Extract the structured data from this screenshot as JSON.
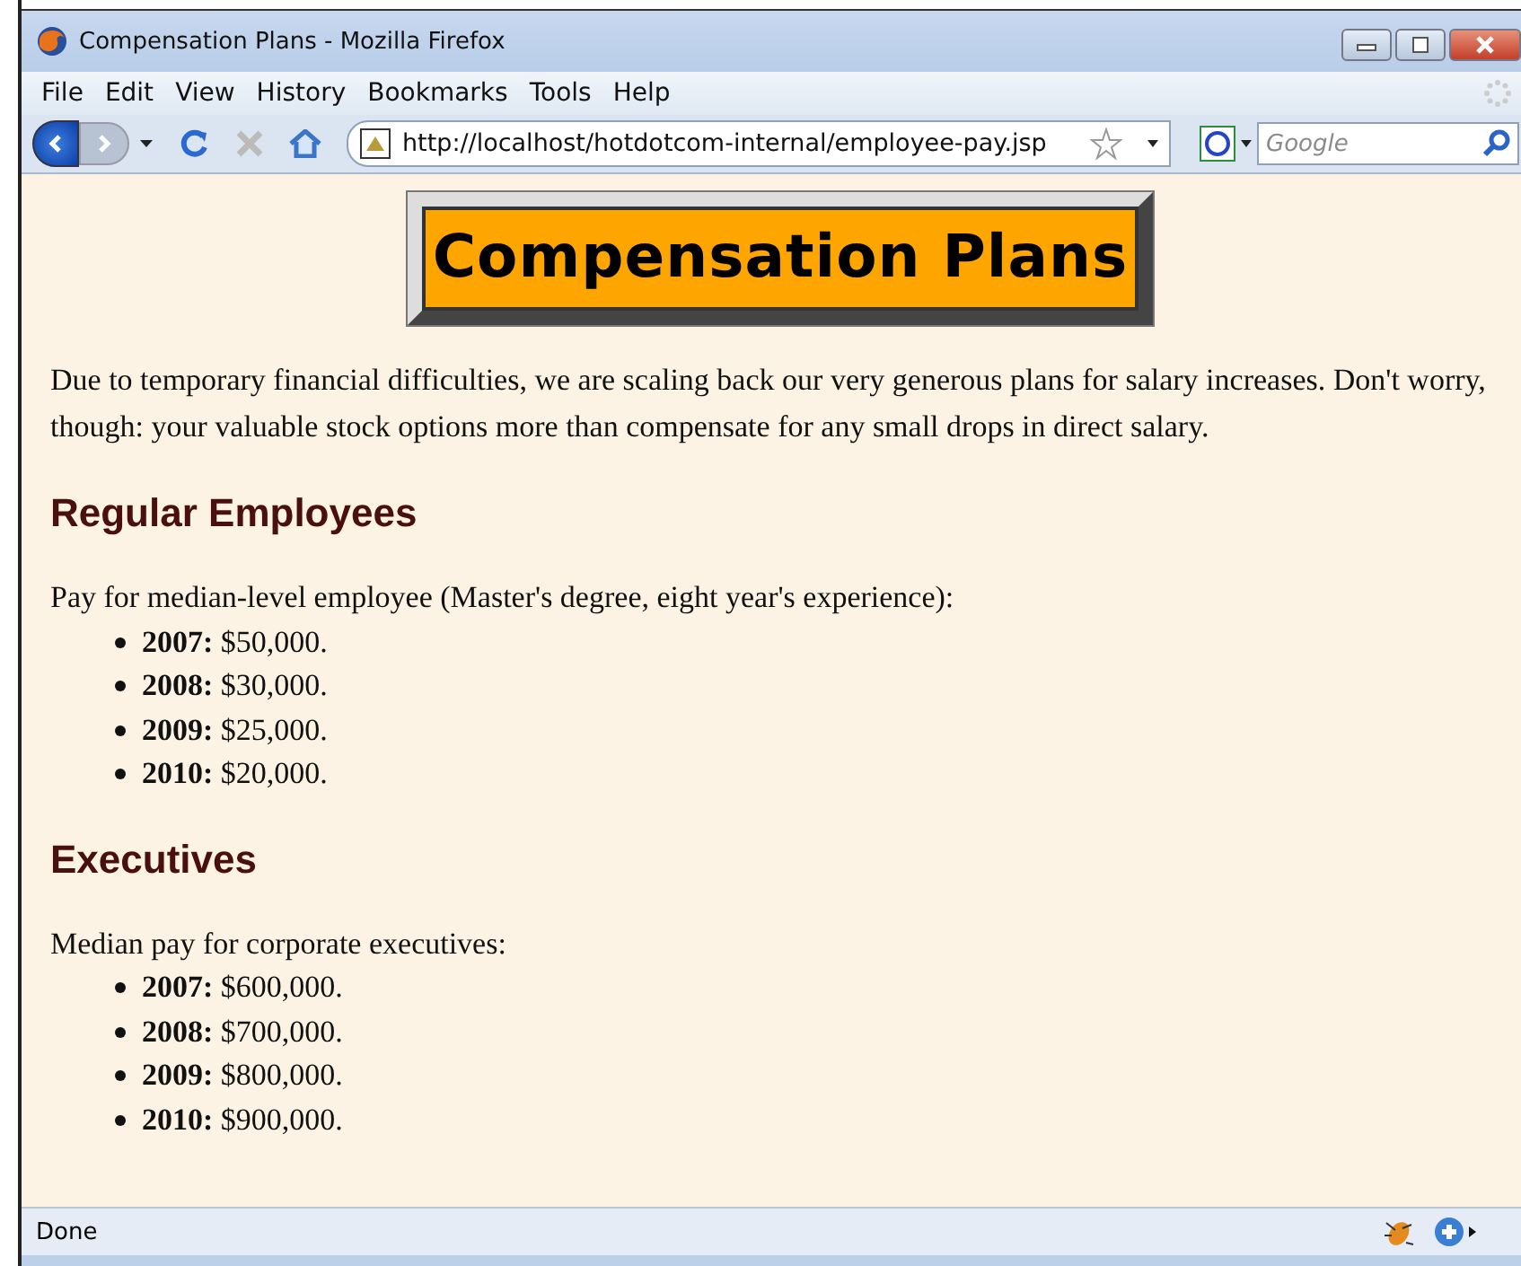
{
  "window": {
    "title": "Compensation Plans - Mozilla Firefox"
  },
  "menu": [
    "File",
    "Edit",
    "View",
    "History",
    "Bookmarks",
    "Tools",
    "Help"
  ],
  "address_bar": {
    "value": "http://localhost/hotdotcom-internal/employee-pay.jsp"
  },
  "search": {
    "placeholder": "Google"
  },
  "page": {
    "banner": "Compensation Plans",
    "intro": "Due to temporary financial difficulties, we are scaling back our very generous plans for salary increases. Don't worry, though: your valuable stock options more than compensate for any small drops in direct salary.",
    "sections": [
      {
        "heading": "Regular Employees",
        "lead": "Pay for median-level employee (Master's degree, eight year's experience):",
        "items": [
          {
            "year": "2007:",
            "amount": "$50,000."
          },
          {
            "year": "2008:",
            "amount": "$30,000."
          },
          {
            "year": "2009:",
            "amount": "$25,000."
          },
          {
            "year": "2010:",
            "amount": "$20,000."
          }
        ]
      },
      {
        "heading": "Executives",
        "lead": "Median pay for corporate executives:",
        "items": [
          {
            "year": "2007:",
            "amount": "$600,000."
          },
          {
            "year": "2008:",
            "amount": "$700,000."
          },
          {
            "year": "2009:",
            "amount": "$800,000."
          },
          {
            "year": "2010:",
            "amount": "$900,000."
          }
        ]
      }
    ]
  },
  "status_bar": {
    "text": "Done"
  }
}
